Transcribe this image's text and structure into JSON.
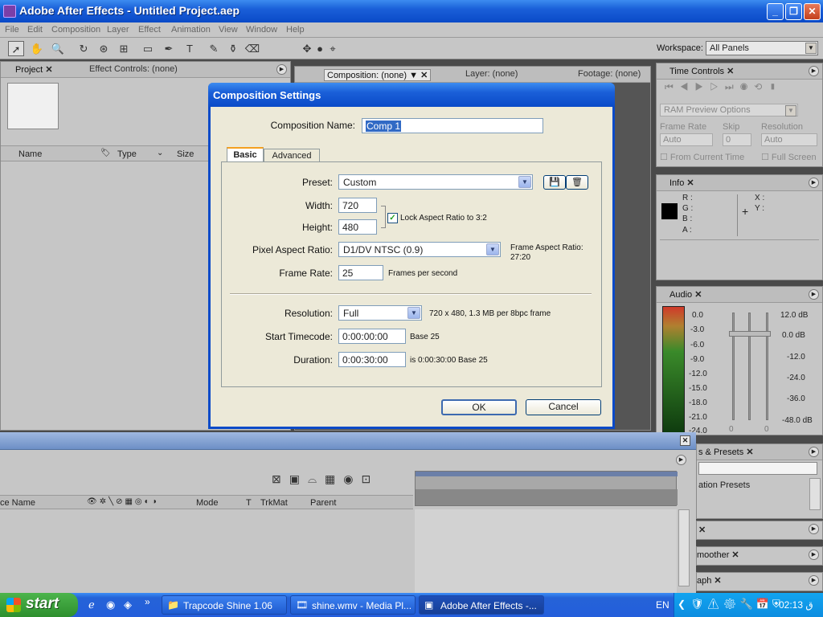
{
  "window": {
    "title": "Adobe After Effects - Untitled Project.aep",
    "min": "_",
    "max": "❐",
    "close": "✕"
  },
  "menu": [
    "File",
    "Edit",
    "Composition",
    "Layer",
    "Effect",
    "Animation",
    "View",
    "Window",
    "Help"
  ],
  "toolbar": {
    "workspace_label": "Workspace:",
    "workspace_value": "All Panels"
  },
  "project_panel": {
    "tabs": [
      "Project",
      "Effect Controls: (none)"
    ],
    "columns": [
      "Name",
      "Type",
      "Size"
    ]
  },
  "comp_panel": {
    "tabs": [
      "Composition: (none)",
      "Layer: (none)",
      "Footage: (none)"
    ]
  },
  "time_controls": {
    "tab": "Time Controls",
    "ram_preview": "RAM Preview Options",
    "frame_rate_label": "Frame Rate",
    "skip_label": "Skip",
    "resolution_label": "Resolution",
    "frame_rate_value": "Auto",
    "skip_value": "0",
    "resolution_value": "Auto",
    "from_current_time": "From Current Time",
    "full_screen": "Full Screen"
  },
  "info_panel": {
    "tab": "Info",
    "r": "R :",
    "g": "G :",
    "b": "B :",
    "a": "A :",
    "x": "X :",
    "y": "Y :"
  },
  "audio_panel": {
    "tab": "Audio",
    "left_scale": [
      "0.0",
      "-3.0",
      "-6.0",
      "-9.0",
      "-12.0",
      "-15.0",
      "-18.0",
      "-21.0",
      "-24.0"
    ],
    "right_scale": [
      "12.0 dB",
      "0.0 dB",
      "-12.0",
      "-24.0",
      "-36.0",
      "-48.0 dB"
    ],
    "slider_zero_a": "0",
    "slider_zero_b": "0"
  },
  "effects_panel": {
    "tab": "s & Presets",
    "item": "ation Presets"
  },
  "smoother_panel": {
    "tab": "moother"
  },
  "graph_panel": {
    "tab": "aph"
  },
  "timeline": {
    "columns": [
      "ce Name",
      "Mode",
      "T",
      "TrkMat",
      "Parent"
    ]
  },
  "dialog": {
    "title": "Composition Settings",
    "comp_name_label": "Composition Name:",
    "comp_name_value": "Comp 1",
    "tabs": [
      "Basic",
      "Advanced"
    ],
    "preset_label": "Preset:",
    "preset_value": "Custom",
    "width_label": "Width:",
    "width_value": "720",
    "height_label": "Height:",
    "height_value": "480",
    "lock_aspect": "Lock Aspect Ratio to 3:2",
    "par_label": "Pixel Aspect Ratio:",
    "par_value": "D1/DV NTSC (0.9)",
    "frame_aspect_label": "Frame Aspect Ratio:",
    "frame_aspect_value": "27:20",
    "frame_rate_label": "Frame Rate:",
    "frame_rate_value": "25",
    "frame_rate_unit": "Frames per second",
    "resolution_label": "Resolution:",
    "resolution_value": "Full",
    "resolution_info": "720 x 480, 1.3 MB per 8bpc frame",
    "start_tc_label": "Start Timecode:",
    "start_tc_value": "0:00:00:00",
    "start_tc_base": "Base 25",
    "duration_label": "Duration:",
    "duration_value": "0:00:30:00",
    "duration_info": "is 0:00:30:00  Base 25",
    "ok": "OK",
    "cancel": "Cancel"
  },
  "taskbar": {
    "start": "start",
    "tasks": [
      "Trapcode Shine 1.06",
      "shine.wmv - Media Pl...",
      "Adobe After Effects -..."
    ],
    "lang": "EN",
    "clock": "02:13 ق"
  }
}
